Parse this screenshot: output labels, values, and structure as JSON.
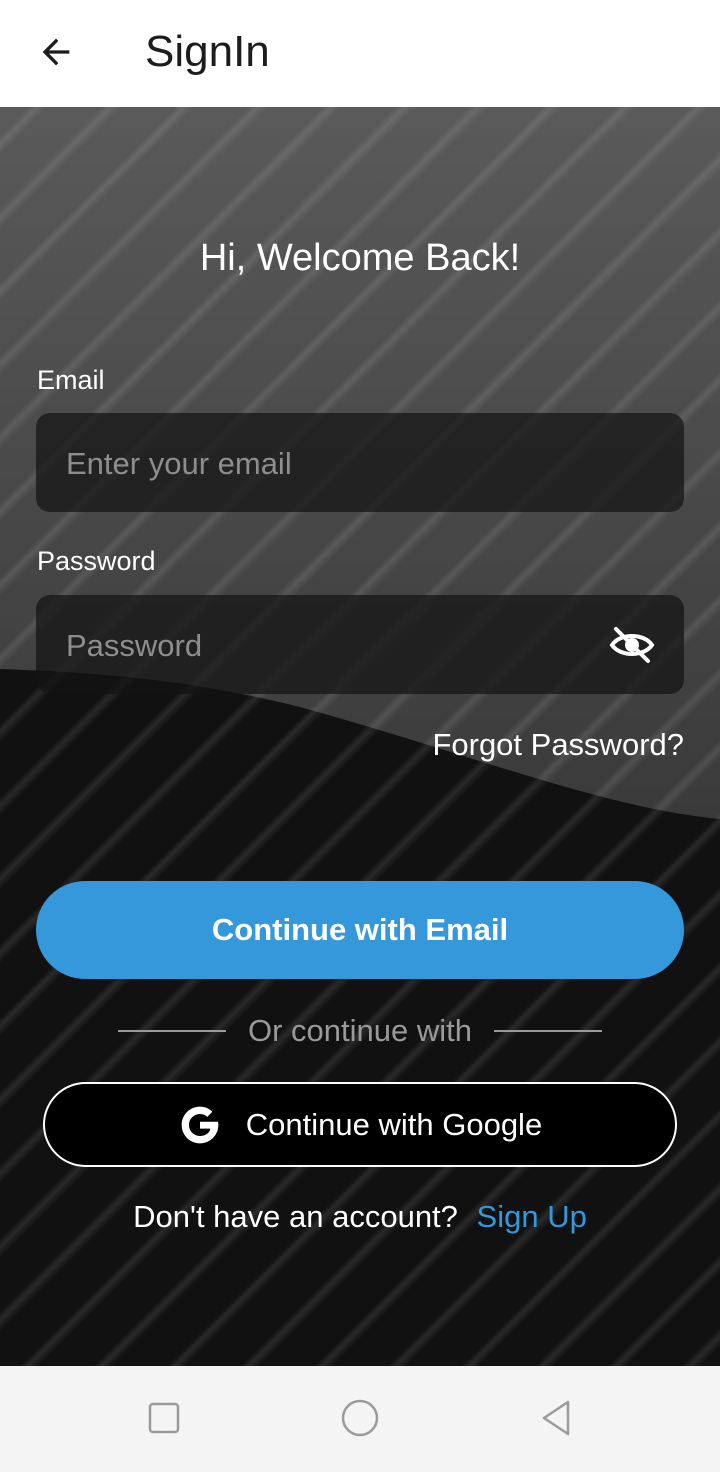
{
  "appbar": {
    "title": "SignIn",
    "back_icon": "arrow-left-icon"
  },
  "form": {
    "welcome": "Hi, Welcome Back!",
    "email_label": "Email",
    "email_placeholder": "Enter your email",
    "email_value": "",
    "password_label": "Password",
    "password_placeholder": "Password",
    "password_value": "",
    "password_toggle_icon": "eye-off-icon",
    "forgot_password": "Forgot Password?",
    "primary_button": "Continue with Email",
    "divider_text": "Or continue with",
    "google_button": "Continue with Google",
    "google_icon": "google-icon",
    "signup_prompt": "Don't have an account?",
    "signup_link": "Sign Up"
  },
  "navbar": {
    "recents_icon": "square-icon",
    "home_icon": "circle-icon",
    "back_icon": "triangle-back-icon"
  },
  "colors": {
    "accent": "#3498db",
    "background": "#111111",
    "field": "#1a1a1a"
  }
}
